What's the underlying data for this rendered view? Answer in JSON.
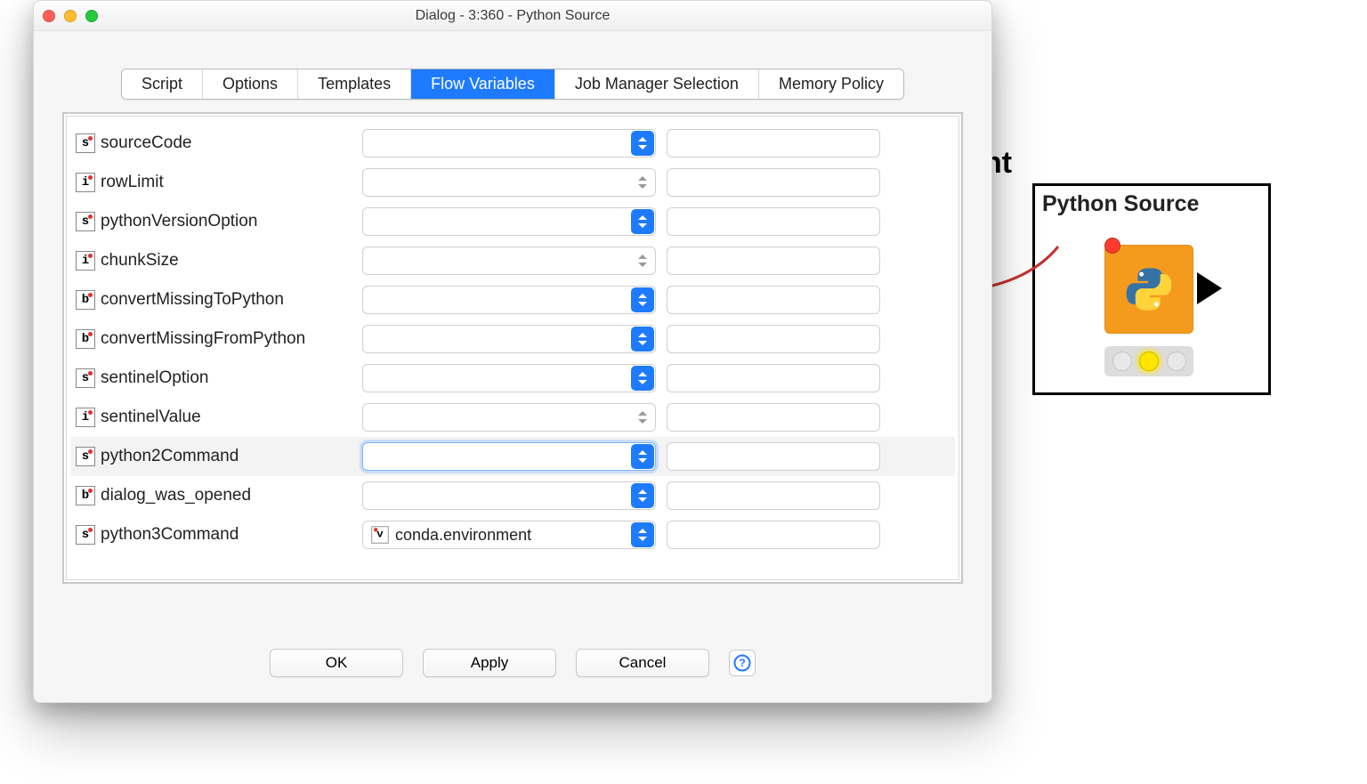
{
  "window": {
    "title": "Dialog - 3:360 - Python Source"
  },
  "tabs": [
    {
      "label": "Script",
      "selected": false
    },
    {
      "label": "Options",
      "selected": false
    },
    {
      "label": "Templates",
      "selected": false
    },
    {
      "label": "Flow Variables",
      "selected": true
    },
    {
      "label": "Job Manager Selection",
      "selected": false
    },
    {
      "label": "Memory Policy",
      "selected": false
    }
  ],
  "flow_variables": [
    {
      "type": "s",
      "name": "sourceCode",
      "combo": "",
      "combo_enabled": true,
      "text": ""
    },
    {
      "type": "i",
      "name": "rowLimit",
      "combo": "",
      "combo_enabled": false,
      "text": ""
    },
    {
      "type": "s",
      "name": "pythonVersionOption",
      "combo": "",
      "combo_enabled": true,
      "text": ""
    },
    {
      "type": "i",
      "name": "chunkSize",
      "combo": "",
      "combo_enabled": false,
      "text": ""
    },
    {
      "type": "b",
      "name": "convertMissingToPython",
      "combo": "",
      "combo_enabled": true,
      "text": ""
    },
    {
      "type": "b",
      "name": "convertMissingFromPython",
      "combo": "",
      "combo_enabled": true,
      "text": ""
    },
    {
      "type": "s",
      "name": "sentinelOption",
      "combo": "",
      "combo_enabled": true,
      "text": ""
    },
    {
      "type": "i",
      "name": "sentinelValue",
      "combo": "",
      "combo_enabled": false,
      "text": ""
    },
    {
      "type": "s",
      "name": "python2Command",
      "combo": "",
      "combo_enabled": true,
      "text": "",
      "focused": true
    },
    {
      "type": "b",
      "name": "dialog_was_opened",
      "combo": "",
      "combo_enabled": true,
      "text": ""
    },
    {
      "type": "s",
      "name": "python3Command",
      "combo": "conda.environment",
      "combo_badge": "v",
      "combo_enabled": true,
      "text": ""
    }
  ],
  "buttons": {
    "ok": "OK",
    "apply": "Apply",
    "cancel": "Cancel"
  },
  "node": {
    "title": "Python Source",
    "status": "configured-yellow"
  },
  "bg_fragment": "nt"
}
